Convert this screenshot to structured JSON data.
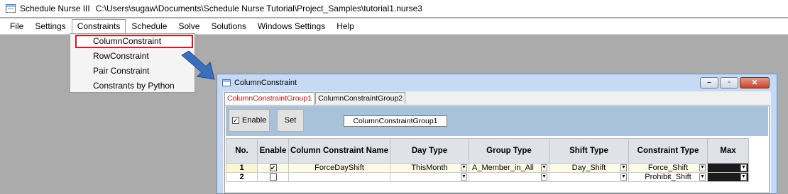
{
  "window": {
    "app_name": "Schedule Nurse III",
    "file_path": "C:\\Users\\sugaw\\Documents\\Schedule Nurse Tutorial\\Project_Samples\\tutorial1.nurse3"
  },
  "menu": [
    "File",
    "Settings",
    "Constraints",
    "Schedule",
    "Solve",
    "Solutions",
    "Windows Settings",
    "Help"
  ],
  "constraints_menu": [
    "ColumnConstraint",
    "RowConstraint",
    "Pair Constraint",
    "Constrants by Python"
  ],
  "child_window": {
    "title": "ColumnConstraint",
    "tabs": [
      "ColumnConstraintGroup1",
      "ColumnConstraintGroup2"
    ],
    "enable_label": "Enable",
    "enable_checked": true,
    "set_label": "Set",
    "group_name": "ColumnConstraintGroup1"
  },
  "grid": {
    "columns": [
      "No.",
      "Enable",
      "Column Constraint Name",
      "Day Type",
      "Group Type",
      "Shift Type",
      "Constraint Type",
      "Max"
    ],
    "rows": [
      {
        "no": "1",
        "enable": "✔",
        "name": "ForceDayShift",
        "day_type": "ThisMonth",
        "group_type": "A_Member_in_All",
        "shift_type": "Day_Shift",
        "constraint_type": "Force_Shift",
        "max": ""
      },
      {
        "no": "2",
        "enable": "",
        "name": "",
        "day_type": "",
        "group_type": "",
        "shift_type": "",
        "constraint_type": "Prohibit_Shift",
        "max": ""
      }
    ]
  },
  "colors": {
    "highlight_red": "#e0141c",
    "arrow_blue": "#3a6fbd",
    "panel_blue": "#a9c2db"
  }
}
